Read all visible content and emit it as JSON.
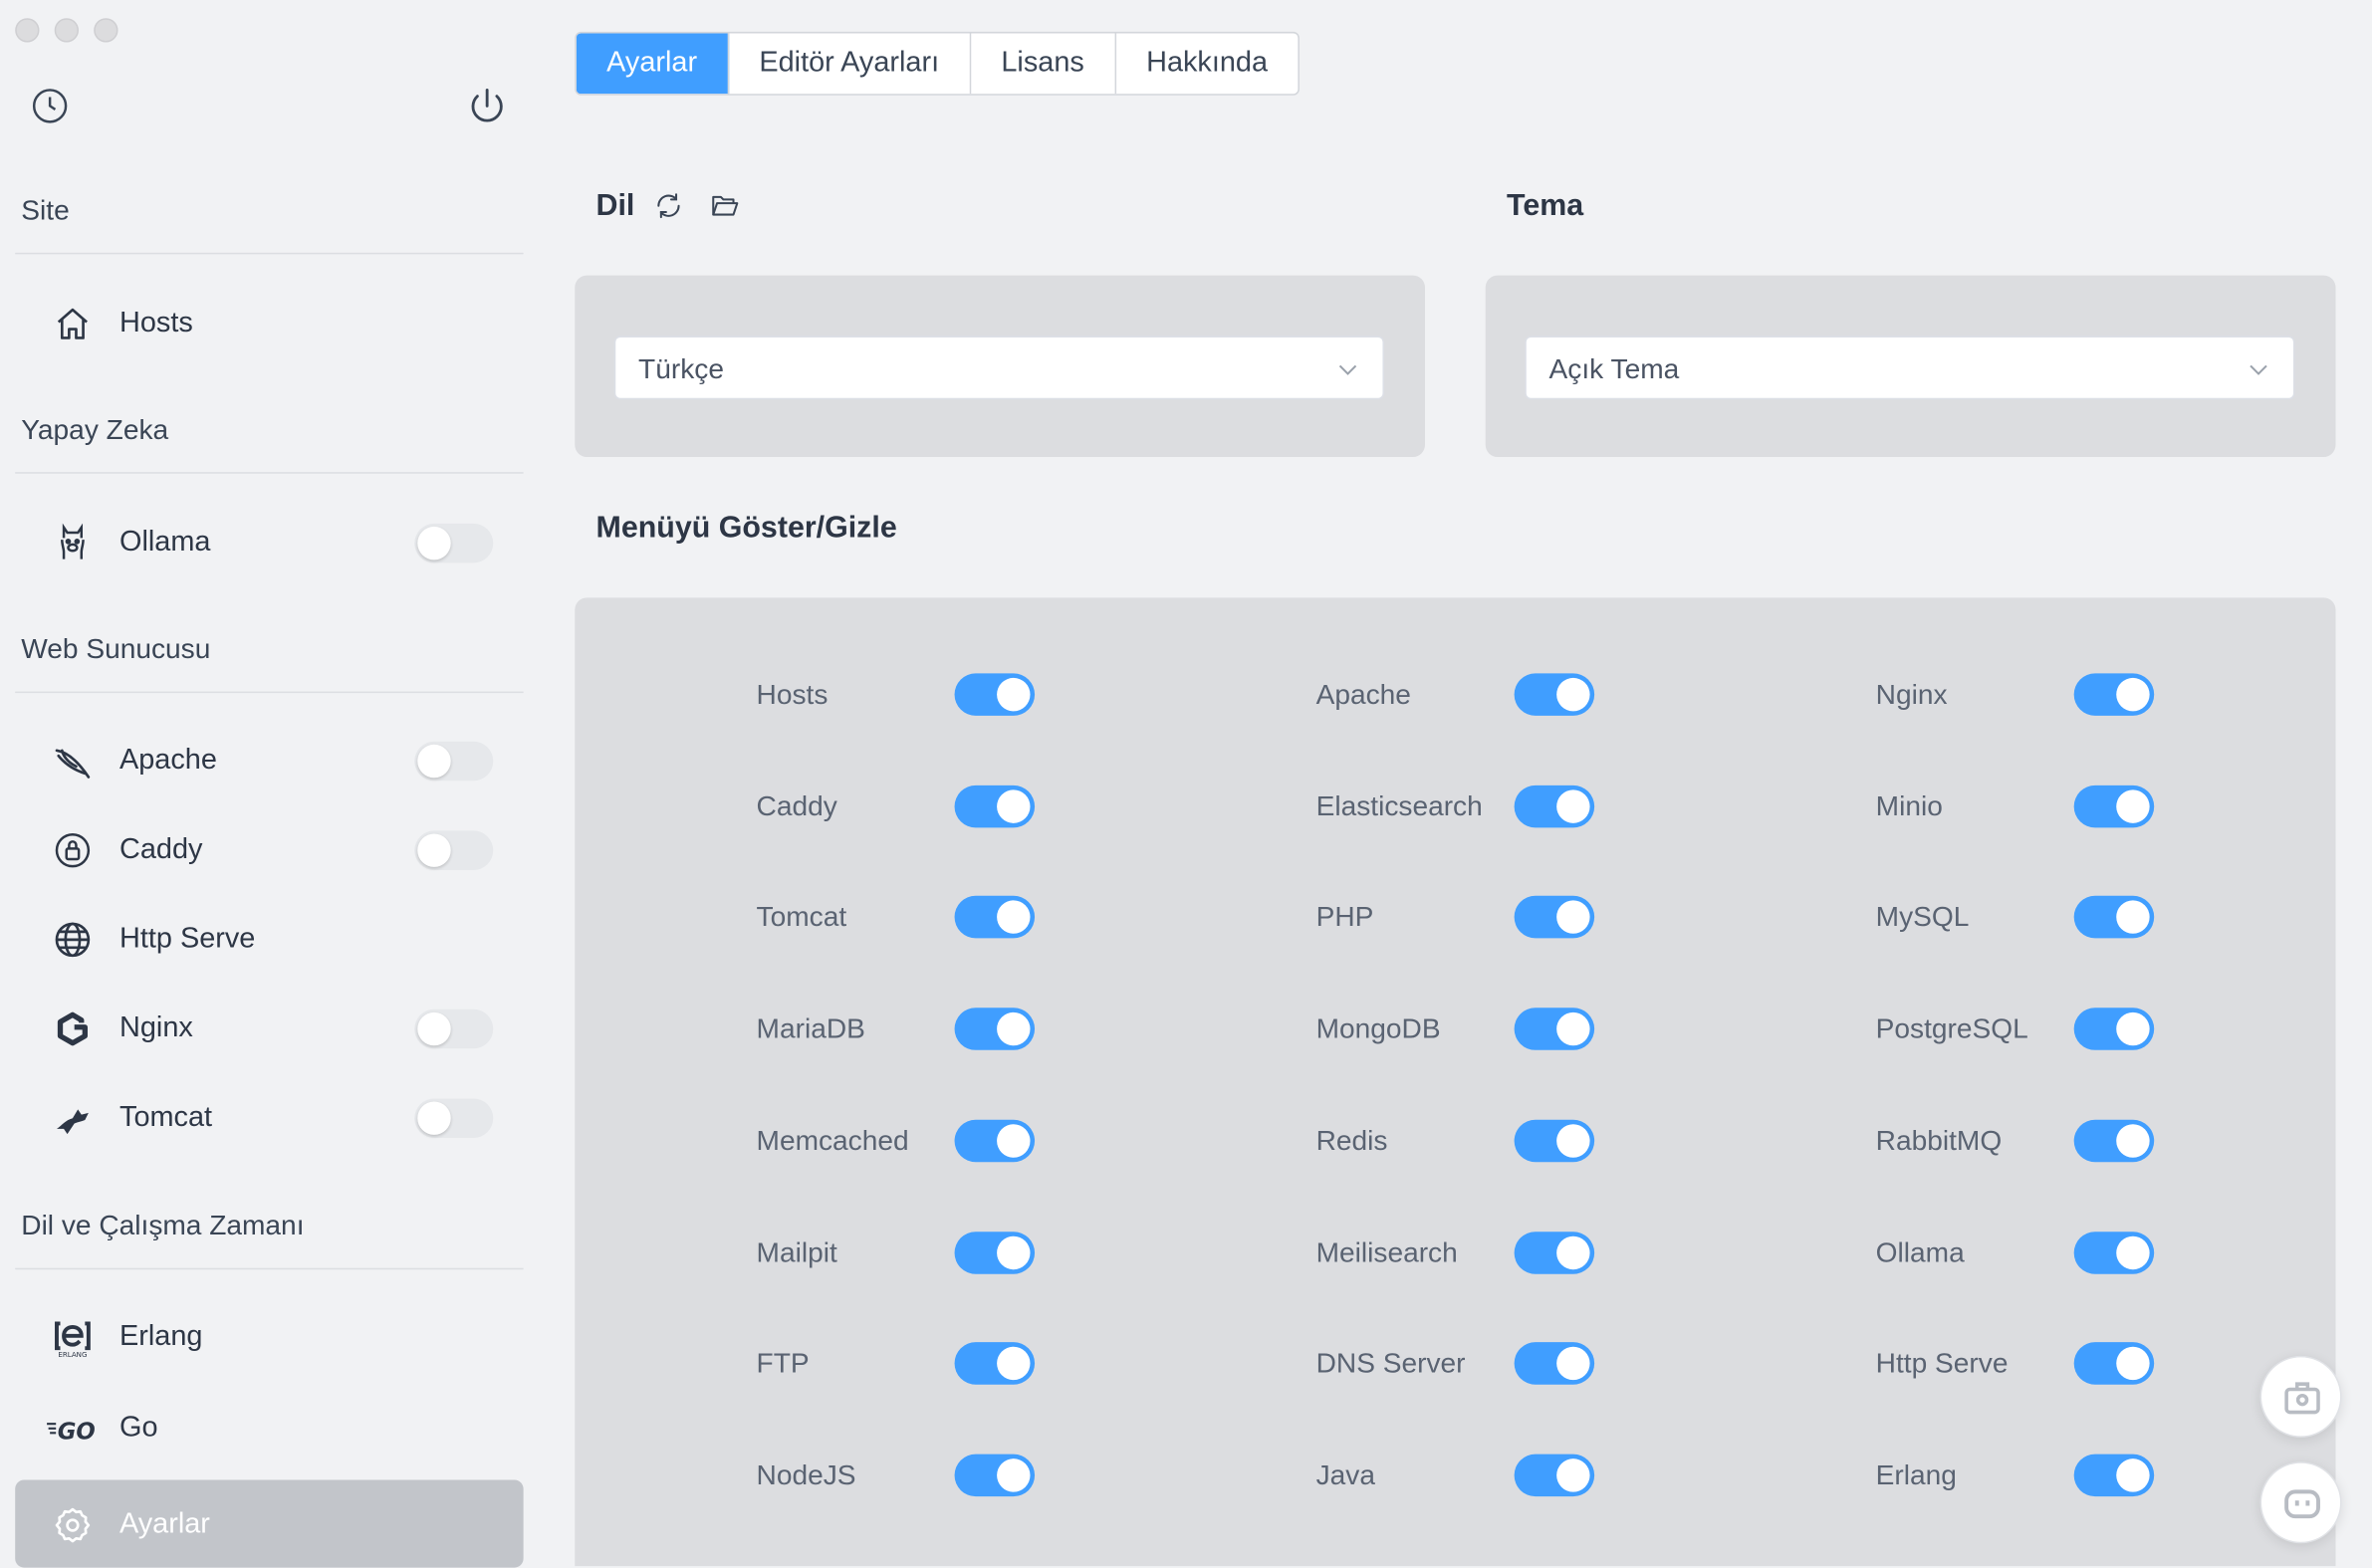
{
  "sidebar": {
    "top_icons": {
      "history": "clock-icon",
      "power": "power-icon"
    },
    "sections": {
      "site": "Site",
      "ai": "Yapay Zeka",
      "web": "Web Sunucusu",
      "lang": "Dil ve Çalışma Zamanı"
    },
    "items": {
      "hosts": "Hosts",
      "ollama": "Ollama",
      "apache": "Apache",
      "caddy": "Caddy",
      "http_serve": "Http Serve",
      "nginx": "Nginx",
      "tomcat": "Tomcat",
      "erlang": "Erlang",
      "erlang_sub": "ERLANG",
      "go": "Go",
      "go_logo": "GO",
      "settings": "Ayarlar"
    }
  },
  "tabs": [
    "Ayarlar",
    "Editör Ayarları",
    "Lisans",
    "Hakkında"
  ],
  "active_tab": "Ayarlar",
  "language": {
    "heading": "Dil",
    "selected": "Türkçe"
  },
  "theme": {
    "heading": "Tema",
    "selected": "Açık Tema"
  },
  "menu_toggle": {
    "heading": "Menüyü Göster/Gizle",
    "items": [
      "Hosts",
      "Apache",
      "Nginx",
      "Caddy",
      "Elasticsearch",
      "Minio",
      "Tomcat",
      "PHP",
      "MySQL",
      "MariaDB",
      "MongoDB",
      "PostgreSQL",
      "Memcached",
      "Redis",
      "RabbitMQ",
      "Mailpit",
      "Meilisearch",
      "Ollama",
      "FTP",
      "DNS Server",
      "Http Serve",
      "NodeJS",
      "Java",
      "Erlang"
    ],
    "all_enabled": true
  },
  "colors": {
    "accent": "#409eff",
    "sidebar_active": "#c2c5ca",
    "panel": "#dcdde0",
    "background": "#f1f2f4"
  }
}
